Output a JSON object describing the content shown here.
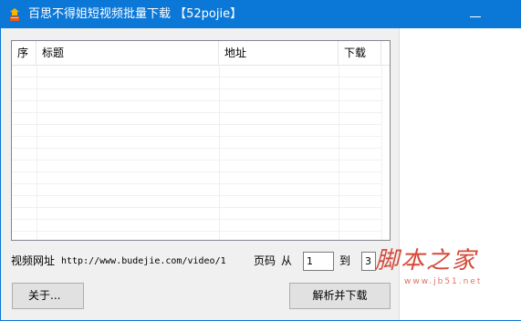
{
  "window": {
    "title": "百思不得姐短视频批量下载  【52pojie】",
    "colors": {
      "titlebar": "#0b78d7",
      "background": "#f0f0f0"
    }
  },
  "list": {
    "columns": [
      "序",
      "标题",
      "地址",
      "下载"
    ],
    "rows": []
  },
  "form": {
    "url_label": "视频网址",
    "url_value": "http://www.budejie.com/video/1",
    "page_label": "页码",
    "from_label": "从",
    "to_label": "到",
    "page_from": "1",
    "page_to": "3"
  },
  "buttons": {
    "about": "关于...",
    "parse_download": "解析并下载"
  },
  "watermark": {
    "logo": "脚本之家",
    "url": "www.jb51.net"
  }
}
